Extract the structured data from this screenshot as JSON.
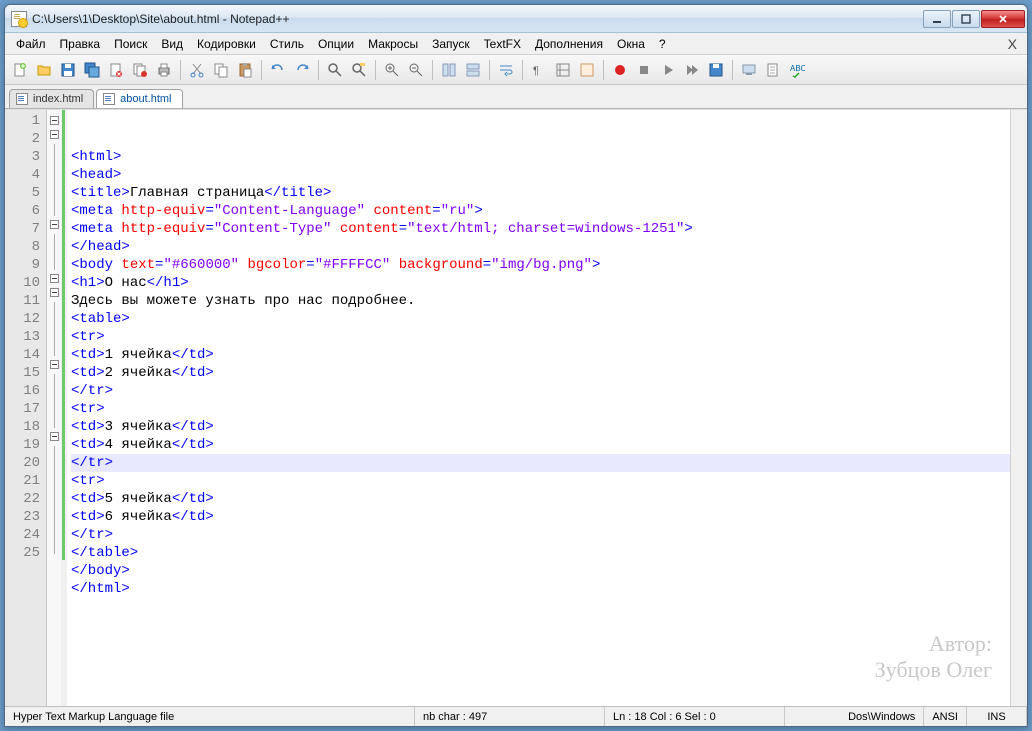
{
  "title": "C:\\Users\\1\\Desktop\\Site\\about.html - Notepad++",
  "menu": [
    "Файл",
    "Правка",
    "Поиск",
    "Вид",
    "Кодировки",
    "Стиль",
    "Опции",
    "Макросы",
    "Запуск",
    "TextFX",
    "Дополнения",
    "Окна",
    "?"
  ],
  "tabs": [
    {
      "label": "index.html",
      "active": false
    },
    {
      "label": "about.html",
      "active": true
    }
  ],
  "code": [
    {
      "n": 1,
      "fold": "box",
      "tokens": [
        [
          "tag",
          "<html>"
        ]
      ]
    },
    {
      "n": 2,
      "fold": "box",
      "tokens": [
        [
          "tag",
          "<head>"
        ]
      ]
    },
    {
      "n": 3,
      "fold": "line",
      "tokens": [
        [
          "tag",
          "<title>"
        ],
        [
          "text",
          "Главная страница"
        ],
        [
          "tag",
          "</title>"
        ]
      ]
    },
    {
      "n": 4,
      "fold": "line",
      "tokens": [
        [
          "tag",
          "<meta "
        ],
        [
          "attr",
          "http-equiv"
        ],
        [
          "tag",
          "="
        ],
        [
          "str",
          "\"Content-Language\""
        ],
        [
          "tag",
          " "
        ],
        [
          "attr",
          "content"
        ],
        [
          "tag",
          "="
        ],
        [
          "str",
          "\"ru\""
        ],
        [
          "tag",
          ">"
        ]
      ]
    },
    {
      "n": 5,
      "fold": "line",
      "tokens": [
        [
          "tag",
          "<meta "
        ],
        [
          "attr",
          "http-equiv"
        ],
        [
          "tag",
          "="
        ],
        [
          "str",
          "\"Content-Type\""
        ],
        [
          "tag",
          " "
        ],
        [
          "attr",
          "content"
        ],
        [
          "tag",
          "="
        ],
        [
          "str",
          "\"text/html; charset=windows-1251\""
        ],
        [
          "tag",
          ">"
        ]
      ]
    },
    {
      "n": 6,
      "fold": "line",
      "tokens": [
        [
          "tag",
          "</head>"
        ]
      ]
    },
    {
      "n": 7,
      "fold": "box",
      "tokens": [
        [
          "tag",
          "<body "
        ],
        [
          "attr",
          "text"
        ],
        [
          "tag",
          "="
        ],
        [
          "str",
          "\"#660000\""
        ],
        [
          "tag",
          " "
        ],
        [
          "attr",
          "bgcolor"
        ],
        [
          "tag",
          "="
        ],
        [
          "str",
          "\"#FFFFCC\""
        ],
        [
          "tag",
          " "
        ],
        [
          "attr",
          "background"
        ],
        [
          "tag",
          "="
        ],
        [
          "str",
          "\"img/bg.png\""
        ],
        [
          "tag",
          ">"
        ]
      ]
    },
    {
      "n": 8,
      "fold": "line",
      "tokens": [
        [
          "tag",
          "<h1>"
        ],
        [
          "text",
          "О нас"
        ],
        [
          "tag",
          "</h1>"
        ]
      ]
    },
    {
      "n": 9,
      "fold": "line",
      "tokens": [
        [
          "text",
          "Здесь вы можете узнать про нас подробнее."
        ]
      ]
    },
    {
      "n": 10,
      "fold": "box",
      "tokens": [
        [
          "tag",
          "<table>"
        ]
      ]
    },
    {
      "n": 11,
      "fold": "box",
      "tokens": [
        [
          "tag",
          "<tr>"
        ]
      ]
    },
    {
      "n": 12,
      "fold": "line",
      "tokens": [
        [
          "tag",
          "<td>"
        ],
        [
          "text",
          "1 ячейка"
        ],
        [
          "tag",
          "</td>"
        ]
      ]
    },
    {
      "n": 13,
      "fold": "line",
      "tokens": [
        [
          "tag",
          "<td>"
        ],
        [
          "text",
          "2 ячейка"
        ],
        [
          "tag",
          "</td>"
        ]
      ]
    },
    {
      "n": 14,
      "fold": "line",
      "tokens": [
        [
          "tag",
          "</tr>"
        ]
      ]
    },
    {
      "n": 15,
      "fold": "box",
      "tokens": [
        [
          "tag",
          "<tr>"
        ]
      ]
    },
    {
      "n": 16,
      "fold": "line",
      "tokens": [
        [
          "tag",
          "<td>"
        ],
        [
          "text",
          "3 ячейка"
        ],
        [
          "tag",
          "</td>"
        ]
      ]
    },
    {
      "n": 17,
      "fold": "line",
      "tokens": [
        [
          "tag",
          "<td>"
        ],
        [
          "text",
          "4 ячейка"
        ],
        [
          "tag",
          "</td>"
        ]
      ]
    },
    {
      "n": 18,
      "fold": "line",
      "current": true,
      "tokens": [
        [
          "tag",
          "</tr>"
        ]
      ]
    },
    {
      "n": 19,
      "fold": "box",
      "tokens": [
        [
          "tag",
          "<tr>"
        ]
      ]
    },
    {
      "n": 20,
      "fold": "line",
      "tokens": [
        [
          "tag",
          "<td>"
        ],
        [
          "text",
          "5 ячейка"
        ],
        [
          "tag",
          "</td>"
        ]
      ]
    },
    {
      "n": 21,
      "fold": "line",
      "tokens": [
        [
          "tag",
          "<td>"
        ],
        [
          "text",
          "6 ячейка"
        ],
        [
          "tag",
          "</td>"
        ]
      ]
    },
    {
      "n": 22,
      "fold": "line",
      "tokens": [
        [
          "tag",
          "</tr>"
        ]
      ]
    },
    {
      "n": 23,
      "fold": "line",
      "tokens": [
        [
          "tag",
          "</table>"
        ]
      ]
    },
    {
      "n": 24,
      "fold": "line",
      "tokens": [
        [
          "tag",
          "</body>"
        ]
      ]
    },
    {
      "n": 25,
      "fold": "line",
      "tokens": [
        [
          "tag",
          "</html>"
        ]
      ]
    }
  ],
  "status": {
    "filetype": "Hyper Text Markup Language file",
    "chars": "nb char : 497",
    "pos": "Ln : 18   Col : 6   Sel : 0",
    "eol": "Dos\\Windows",
    "enc": "ANSI",
    "ins": "INS"
  },
  "watermark": {
    "l1": "Автор:",
    "l2": "Зубцов Олег"
  }
}
